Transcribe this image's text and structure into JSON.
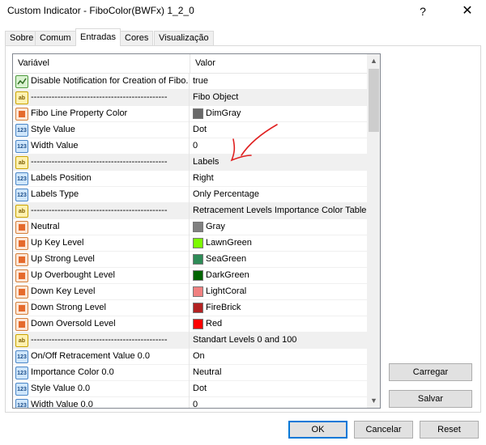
{
  "window": {
    "title": "Custom Indicator - FiboColor(BWFx) 1_2_0",
    "help_glyph": "?",
    "close_glyph": "✕"
  },
  "tabs": [
    {
      "label": "Sobre"
    },
    {
      "label": "Comum"
    },
    {
      "label": "Entradas"
    },
    {
      "label": "Cores"
    },
    {
      "label": "Visualização"
    }
  ],
  "grid": {
    "header_variable": "Variável",
    "header_value": "Valor",
    "rows": [
      {
        "name": "Disable Notification for Creation of Fibo...",
        "value": "true",
        "type": "bool"
      },
      {
        "name": "----------------------------------------------",
        "value": "Fibo Object",
        "type": "str"
      },
      {
        "name": "Fibo Line Property Color",
        "value": "DimGray",
        "type": "col",
        "color": "#696969"
      },
      {
        "name": "Style Value",
        "value": "Dot",
        "type": "num"
      },
      {
        "name": "Width Value",
        "value": "0",
        "type": "num"
      },
      {
        "name": "----------------------------------------------",
        "value": "Labels",
        "type": "str"
      },
      {
        "name": "Labels Position",
        "value": "Right",
        "type": "num"
      },
      {
        "name": "Labels Type",
        "value": "Only Percentage",
        "type": "num"
      },
      {
        "name": "----------------------------------------------",
        "value": "Retracement Levels Importance Color Table",
        "type": "str"
      },
      {
        "name": "Neutral",
        "value": "Gray",
        "type": "col",
        "color": "#808080"
      },
      {
        "name": "Up Key Level",
        "value": "LawnGreen",
        "type": "col",
        "color": "#7cfc00"
      },
      {
        "name": "Up Strong Level",
        "value": "SeaGreen",
        "type": "col",
        "color": "#2e8b57"
      },
      {
        "name": "Up Overbought Level",
        "value": "DarkGreen",
        "type": "col",
        "color": "#006400"
      },
      {
        "name": "Down Key Level",
        "value": "LightCoral",
        "type": "col",
        "color": "#f08080"
      },
      {
        "name": "Down Strong Level",
        "value": "FireBrick",
        "type": "col",
        "color": "#b22222"
      },
      {
        "name": "Down Oversold Level",
        "value": "Red",
        "type": "col",
        "color": "#ff0000"
      },
      {
        "name": "----------------------------------------------",
        "value": "Standart Levels 0 and 100",
        "type": "str"
      },
      {
        "name": "On/Off Retracement Value 0.0",
        "value": "On",
        "type": "num"
      },
      {
        "name": "Importance Color 0.0",
        "value": "Neutral",
        "type": "num"
      },
      {
        "name": "Style Value 0.0",
        "value": "Dot",
        "type": "num"
      },
      {
        "name": "Width Value 0.0",
        "value": "0",
        "type": "num"
      }
    ]
  },
  "icons": {
    "num": "123",
    "str": "ab",
    "bool": "bool-icon",
    "col": "color-icon"
  },
  "scroll": {
    "up_glyph": "▲",
    "down_glyph": "▼"
  },
  "buttons": {
    "load": "Carregar",
    "save": "Salvar",
    "ok": "OK",
    "cancel": "Cancelar",
    "reset": "Reset"
  },
  "colors": {
    "annotation": "#e02020",
    "accent": "#0078d7"
  }
}
